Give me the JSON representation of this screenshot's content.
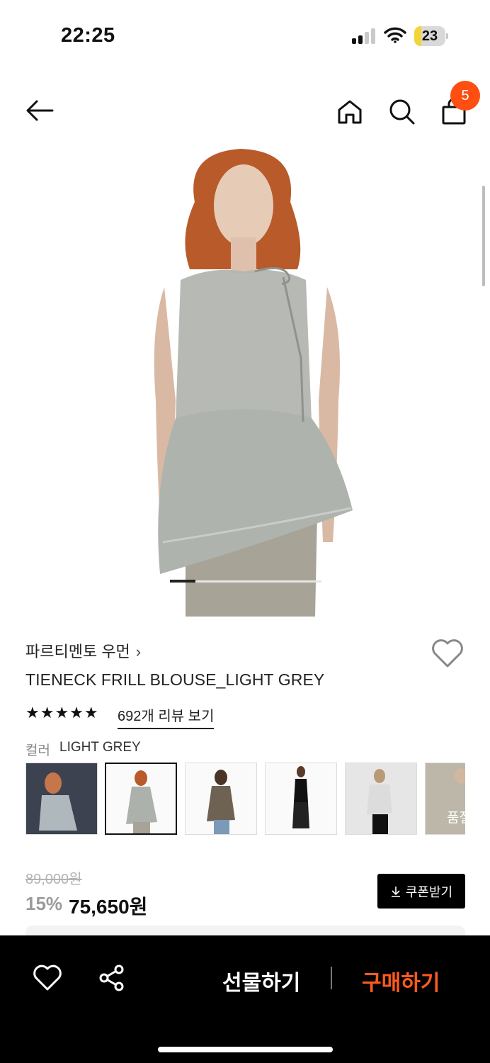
{
  "status_bar": {
    "time": "22:25",
    "battery": "23"
  },
  "header": {
    "cart_count": "5"
  },
  "gallery": {
    "current_index": 1,
    "total": 6
  },
  "product": {
    "brand": "파르티멘토 우먼",
    "brand_chevron": "›",
    "name": "TIENECK FRILL BLOUSE_LIGHT GREY",
    "rating_stars": "★★★★★",
    "review_link": "692개 리뷰 보기",
    "color_label": "컬러",
    "color_value": "LIGHT GREY",
    "thumb_partial_label": "품절",
    "original_price": "89,000원",
    "discount_rate": "15%",
    "sale_price": "75,650원",
    "coupon_label": "쿠폰받기"
  },
  "bottom_bar": {
    "gift_label": "선물하기",
    "buy_label": "구매하기"
  },
  "colors": {
    "accent": "#ff4e12",
    "buy": "#ff5a1f",
    "bar": "#000000"
  },
  "icons": [
    "back-arrow-icon",
    "home-icon",
    "search-icon",
    "cart-icon",
    "heart-icon",
    "star-icon",
    "download-icon",
    "share-icon"
  ]
}
